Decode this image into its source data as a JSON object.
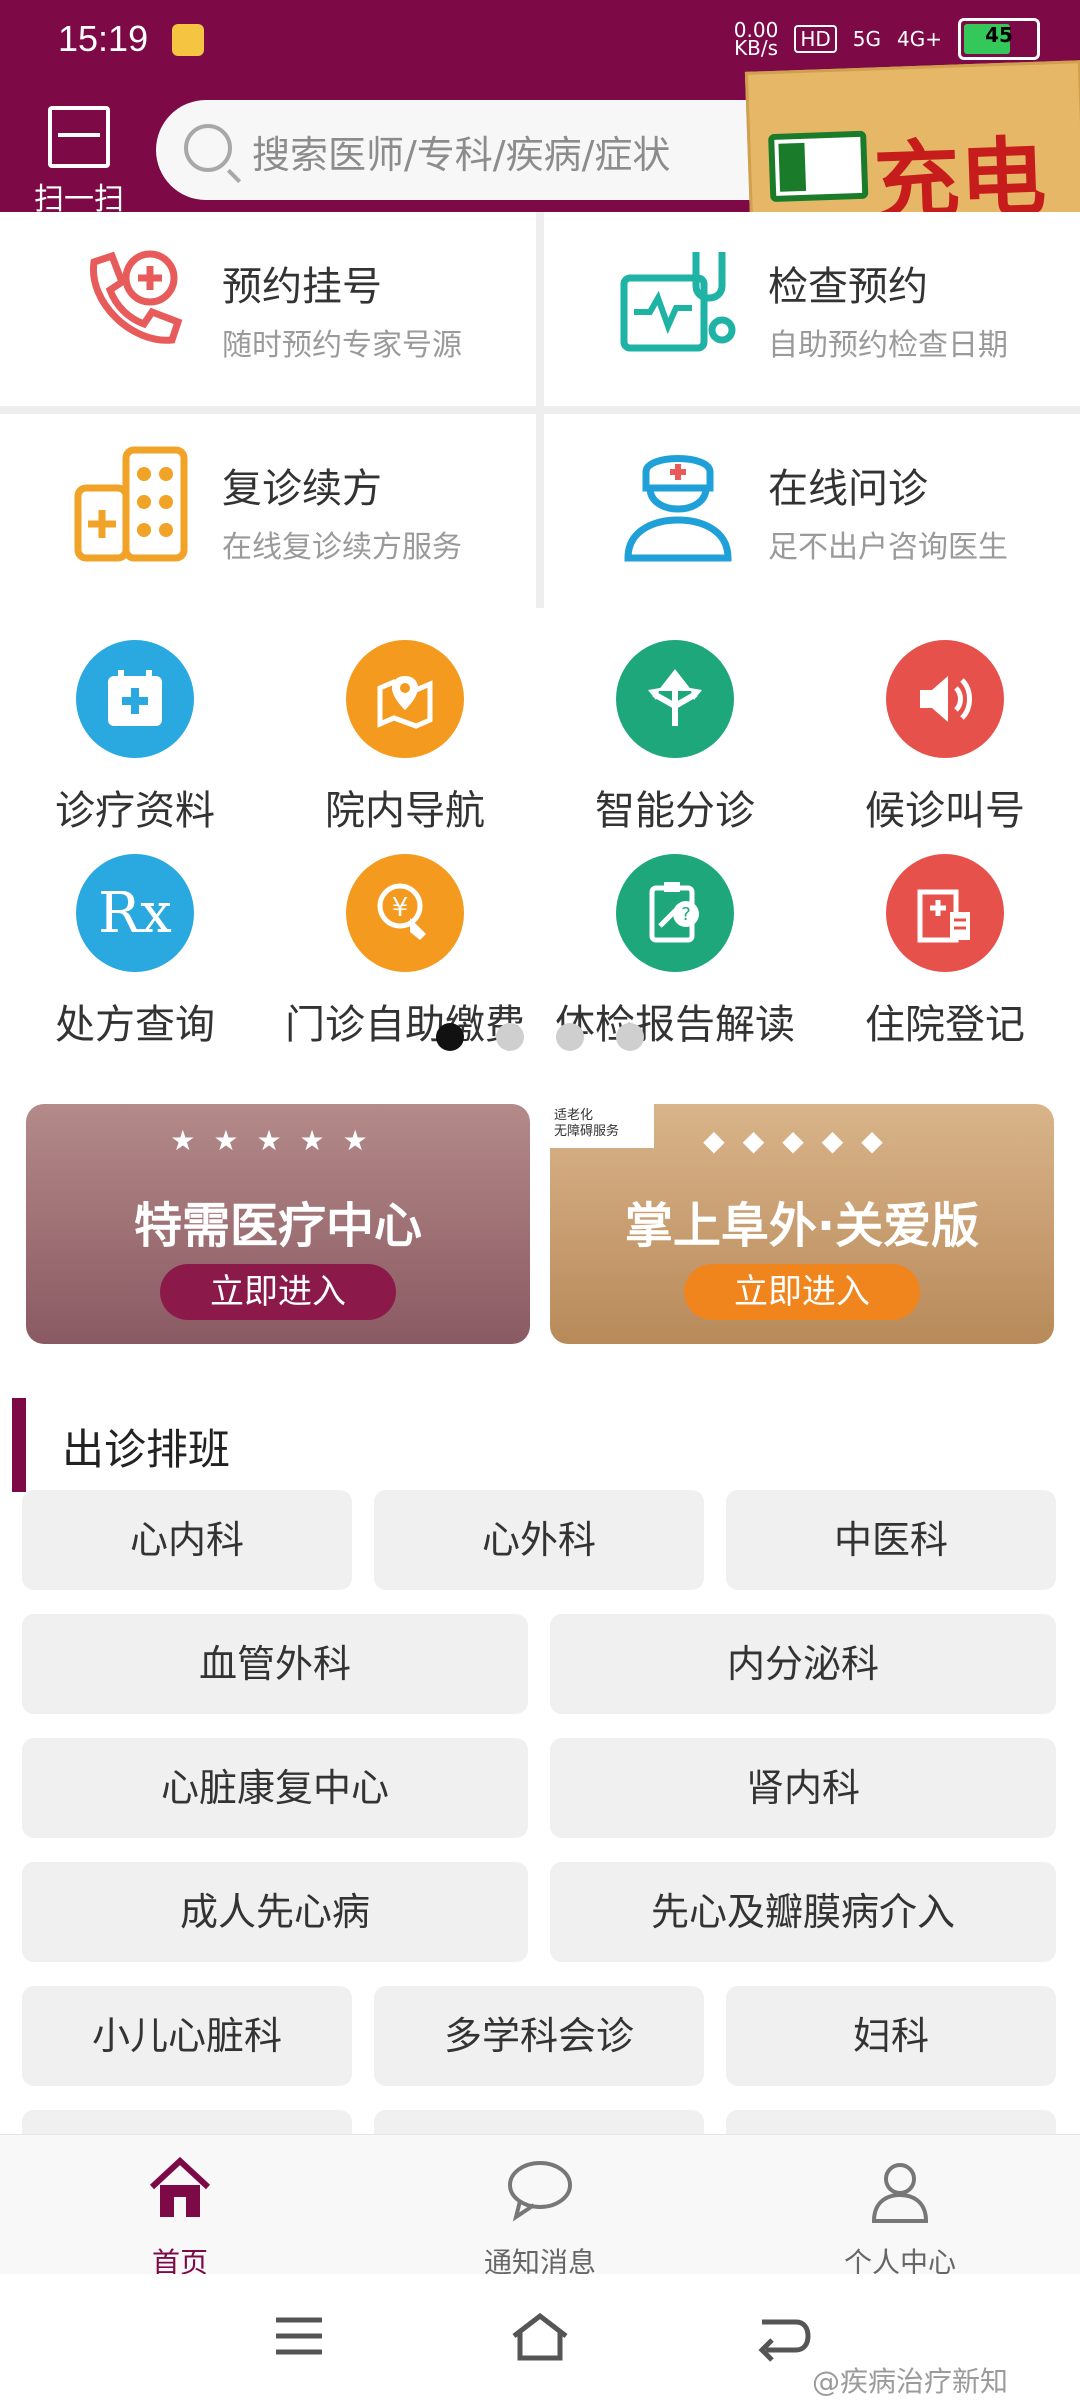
{
  "status_bar": {
    "time": "15:19",
    "network": "0.00\nKB/s",
    "hd": "HD",
    "sig1": "5G",
    "sig2": "4G+",
    "battery": "45"
  },
  "header": {
    "scan_label": "扫一扫",
    "search_placeholder": "搜索医师/专科/疾病/症状",
    "sticker_text": "充电"
  },
  "feature_cards": [
    {
      "title": "预约挂号",
      "subtitle": "随时预约专家号源",
      "icon": "phone-plus-icon",
      "color": "#e85b5b"
    },
    {
      "title": "检查预约",
      "subtitle": "自助预约检查日期",
      "icon": "stethoscope-icon",
      "color": "#1fb3a5"
    },
    {
      "title": "复诊续方",
      "subtitle": "在线复诊续方服务",
      "icon": "medicine-icon",
      "color": "#f0a326"
    },
    {
      "title": "在线问诊",
      "subtitle": "足不出户咨询医生",
      "icon": "doctor-icon",
      "color": "#1fa0d8"
    }
  ],
  "quick_actions": [
    {
      "label": "诊疗资料",
      "icon": "calendar-cross-icon",
      "color": "#2aa8e0",
      "glyph": "+"
    },
    {
      "label": "院内导航",
      "icon": "map-pin-icon",
      "color": "#f39a1f",
      "glyph": "⌂"
    },
    {
      "label": "智能分诊",
      "icon": "split-arrows-icon",
      "color": "#1fa77c",
      "glyph": "⇅"
    },
    {
      "label": "候诊叫号",
      "icon": "speaker-icon",
      "color": "#e6524b",
      "glyph": "♪"
    },
    {
      "label": "处方查询",
      "icon": "rx-icon",
      "color": "#2aa8e0",
      "glyph": "Rx"
    },
    {
      "label": "门诊自助缴费",
      "icon": "yen-coin-icon",
      "color": "#f39a1f",
      "glyph": "¥"
    },
    {
      "label": "体检报告解读",
      "icon": "clipboard-question-icon",
      "color": "#1fa77c",
      "glyph": "?"
    },
    {
      "label": "住院登记",
      "icon": "hospital-building-icon",
      "color": "#e6524b",
      "glyph": "▦"
    }
  ],
  "pager": {
    "count": 4,
    "active_index": 0
  },
  "banners": [
    {
      "title": "特需医疗中心",
      "cta": "立即进入",
      "accent": "#8b1a4b"
    },
    {
      "title": "掌上阜外·关爱版",
      "cta": "立即进入",
      "accent": "#f0851d",
      "tag_line1": "适老化",
      "tag_line2": "无障碍服务"
    }
  ],
  "schedule": {
    "title": "出诊排班",
    "departments": [
      "心内科",
      "心外科",
      "中医科",
      "血管外科",
      "内分泌科",
      "心脏康复中心",
      "肾内科",
      "成人先心病",
      "先心及瓣膜病介入",
      "小儿心脏科",
      "多学科会诊",
      "妇科"
    ]
  },
  "tabbar": {
    "items": [
      {
        "label": "首页",
        "icon": "home-icon",
        "active": true
      },
      {
        "label": "通知消息",
        "icon": "chat-bubble-icon",
        "active": false
      },
      {
        "label": "个人中心",
        "icon": "user-icon",
        "active": false
      }
    ],
    "active_color": "#7d0a47"
  },
  "watermark": "@疾病治疗新知"
}
